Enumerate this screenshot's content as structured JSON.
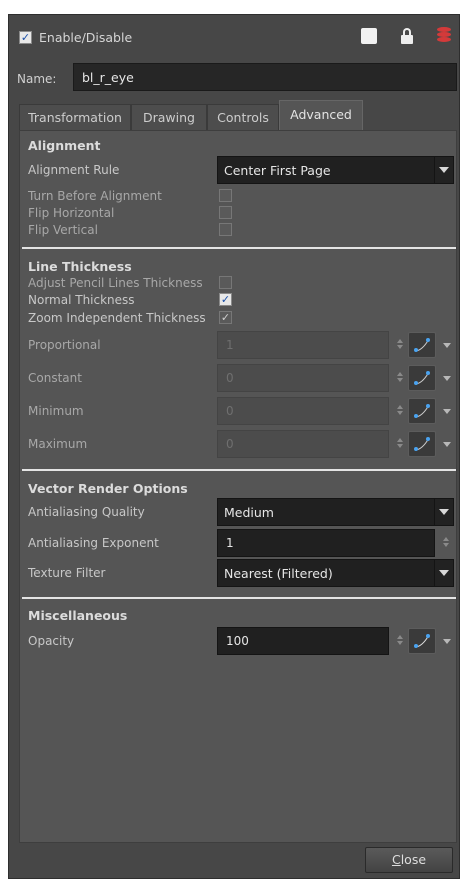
{
  "header": {
    "enable_label": "Enable/Disable",
    "enable_checked": true,
    "icons": [
      "white-square-icon",
      "lock-icon",
      "layer-stack-icon"
    ]
  },
  "name": {
    "label": "Name:",
    "value": "bl_r_eye"
  },
  "tabs": [
    {
      "label": "Transformation",
      "active": false
    },
    {
      "label": "Drawing",
      "active": false
    },
    {
      "label": "Controls",
      "active": false
    },
    {
      "label": "Advanced",
      "active": true
    }
  ],
  "alignment": {
    "title": "Alignment",
    "rule_label": "Alignment Rule",
    "rule_value": "Center First Page",
    "turn_before_label": "Turn Before Alignment",
    "turn_before_checked": false,
    "flip_h_label": "Flip Horizontal",
    "flip_h_checked": false,
    "flip_v_label": "Flip Vertical",
    "flip_v_checked": false
  },
  "line_thickness": {
    "title": "Line Thickness",
    "adjust_label": "Adjust Pencil Lines Thickness",
    "adjust_checked": false,
    "normal_label": "Normal Thickness",
    "normal_checked": true,
    "zoom_label": "Zoom Independent Thickness",
    "zoom_checked": true,
    "proportional_label": "Proportional",
    "proportional_value": "1",
    "constant_label": "Constant",
    "constant_value": "0",
    "minimum_label": "Minimum",
    "minimum_value": "0",
    "maximum_label": "Maximum",
    "maximum_value": "0"
  },
  "vector_render": {
    "title": "Vector Render Options",
    "aa_quality_label": "Antialiasing Quality",
    "aa_quality_value": "Medium",
    "aa_exponent_label": "Antialiasing Exponent",
    "aa_exponent_value": "1",
    "texture_label": "Texture Filter",
    "texture_value": "Nearest (Filtered)"
  },
  "misc": {
    "title": "Miscellaneous",
    "opacity_label": "Opacity",
    "opacity_value": "100"
  },
  "footer": {
    "close_label_first": "C",
    "close_label_rest": "lose"
  },
  "colors": {
    "window_bg": "#474747",
    "panel_bg": "#555555",
    "field_bg": "#202020",
    "check_blue": "#1a4fa8",
    "stack_red": "#d33a3a"
  }
}
